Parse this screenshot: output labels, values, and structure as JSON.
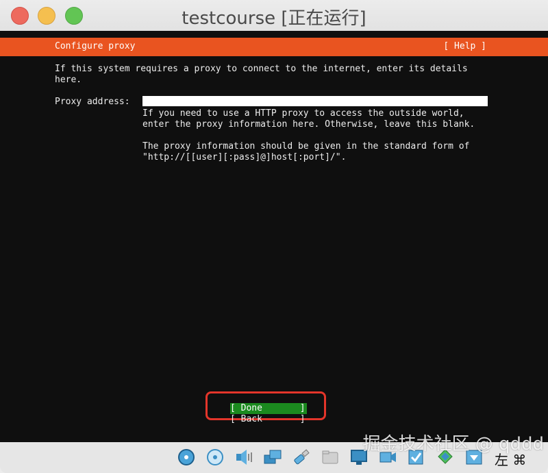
{
  "window": {
    "title": "testcourse [正在运行]"
  },
  "header": {
    "title": "Configure proxy",
    "help_label": "[ Help ]"
  },
  "intro": "If this system requires a proxy to connect to the internet, enter its details here.",
  "proxy": {
    "label": "Proxy address:",
    "value": "",
    "help_line1": "If you need to use a HTTP proxy to access the outside world,",
    "help_line2": "enter the proxy information here. Otherwise, leave this blank.",
    "help_line3": "The proxy information should be given in the standard form of",
    "help_line4": "\"http://[[user][:pass]@]host[:port]/\"."
  },
  "buttons": {
    "done": "[ Done       ]",
    "back": "[ Back       ]"
  },
  "statusbar": {
    "icons": [
      "hard-disk-icon",
      "optical-disk-icon",
      "audio-icon",
      "network-icon",
      "usb-icon",
      "shared-folder-icon",
      "display-icon",
      "recording-icon",
      "guest-additions-icon",
      "mouse-integration-icon",
      "download-icon"
    ],
    "host_key": "左 ⌘"
  },
  "watermark": "掘金技术社区 @ qddd"
}
